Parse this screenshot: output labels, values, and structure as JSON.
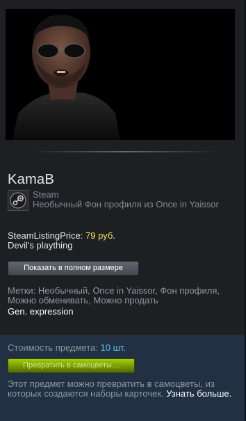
{
  "item": {
    "name": "KamaB",
    "image_alt": "",
    "game": "Steam",
    "type": "Необычный Фон профиля из Once in Yaissor",
    "price_label": "SteamListingPrice:",
    "price_value": "79 руб.",
    "description": "Devil's plaything",
    "view_full_button": "Показать в полном размере",
    "tags": "Метки: Необычный, Once in Yaissor, Фон профиля, Можно обменивать, Можно продать",
    "extra_tag": "Gen. expression"
  },
  "gems": {
    "cost_label": "Стоимость предмета:",
    "cost_value": "10 шт.",
    "button": "Превратить в самоцветы…",
    "description": "Этот предмет можно превратить в самоцветы, из которых создаются наборы карточек.",
    "learn_more": "Узнать больше."
  },
  "colors": {
    "price": "#f7e35b",
    "cost": "#66c0f4",
    "gem_button": "#a4d007"
  },
  "icons": {
    "game_icon": "steam-logo-icon"
  }
}
